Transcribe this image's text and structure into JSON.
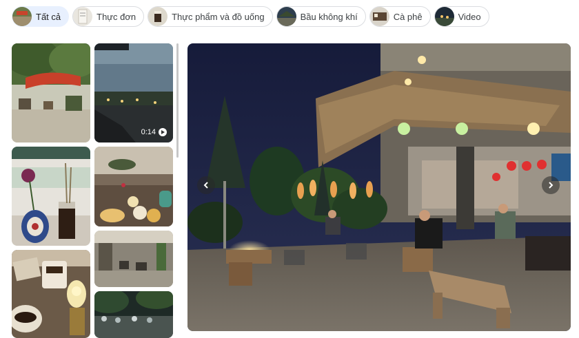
{
  "filters": [
    {
      "label": "Tất cả",
      "selected": true,
      "thumb": "terrace-thumbnail"
    },
    {
      "label": "Thực đơn",
      "selected": false,
      "thumb": "menu-thumbnail"
    },
    {
      "label": "Thực phẩm và đồ uống",
      "selected": false,
      "thumb": "food-drink-thumbnail"
    },
    {
      "label": "Bầu không khí",
      "selected": false,
      "thumb": "atmosphere-thumbnail"
    },
    {
      "label": "Cà phê",
      "selected": false,
      "thumb": "coffee-thumbnail"
    },
    {
      "label": "Video",
      "selected": false,
      "thumb": "video-thumbnail"
    }
  ],
  "gallery": {
    "video_duration": "0:14"
  },
  "viewer": {
    "prev_icon": "chevron-left-icon",
    "next_icon": "chevron-right-icon"
  }
}
